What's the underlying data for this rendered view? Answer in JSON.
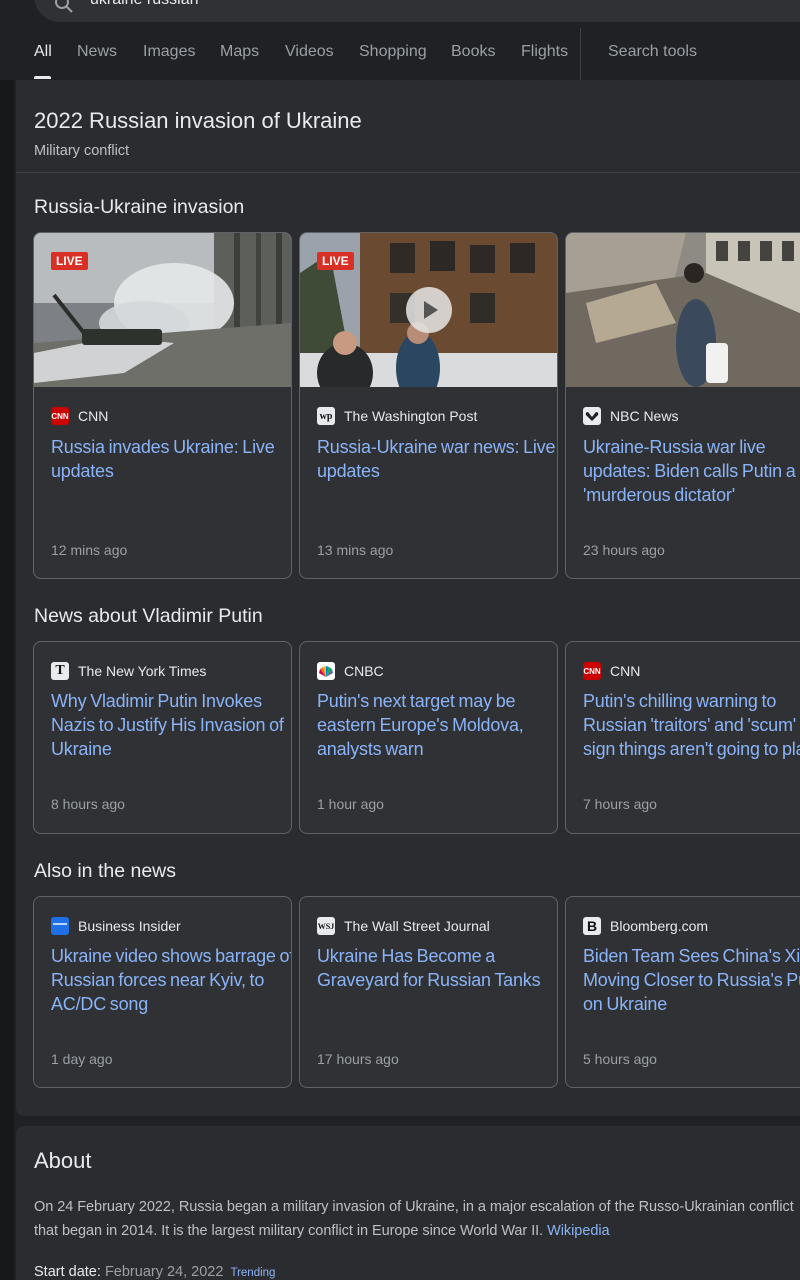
{
  "search": {
    "query": "ukraine russian"
  },
  "tabs": [
    {
      "label": "All",
      "active": true
    },
    {
      "label": "News"
    },
    {
      "label": "Images"
    },
    {
      "label": "Maps"
    },
    {
      "label": "Videos"
    },
    {
      "label": "Shopping"
    },
    {
      "label": "Books"
    },
    {
      "label": "Flights"
    },
    {
      "label": "Search tools"
    }
  ],
  "knowledge_panel": {
    "title": "2022 Russian invasion of Ukraine",
    "subtitle": "Military conflict"
  },
  "sections": [
    {
      "title": "Russia-Ukraine invasion",
      "cards": [
        {
          "badge": "LIVE",
          "source": "CNN",
          "logo": "cnn-logo",
          "headline": "Russia invades Ukraine: Live updates",
          "time": "12 mins ago"
        },
        {
          "badge": "LIVE",
          "source": "The Washington Post",
          "logo": "wapo-logo",
          "headline": "Russia-Ukraine war news: Live updates",
          "time": "13 mins ago",
          "video": true
        },
        {
          "source": "NBC News",
          "logo": "nbc-logo",
          "headline": "Ukraine-Russia war live updates: Biden calls Putin a 'murderous dictator'",
          "time": "23 hours ago"
        }
      ]
    },
    {
      "title": "News about Vladimir Putin",
      "cards": [
        {
          "source": "The New York Times",
          "logo": "nyt-logo",
          "headline": "Why Vladimir Putin Invokes Nazis to Justify His Invasion of Ukraine",
          "time": "8 hours ago"
        },
        {
          "source": "CNBC",
          "logo": "cnbc-logo",
          "headline": "Putin's next target may be eastern Europe's Moldova, analysts warn",
          "time": "1 hour ago"
        },
        {
          "source": "CNN",
          "logo": "cnn-logo",
          "headline": "Putin's chilling warning to Russian 'traitors' and 'scum' is a sign things aren't going to plan",
          "time": "7 hours ago"
        }
      ]
    },
    {
      "title": "Also in the news",
      "cards": [
        {
          "source": "Business Insider",
          "logo": "business-insider-logo",
          "headline": "Ukraine video shows barrage of Russian forces near Kyiv, to AC/DC song",
          "time": "1 day ago"
        },
        {
          "source": "The Wall Street Journal",
          "logo": "wsj-logo",
          "headline": "Ukraine Has Become a Graveyard for Russian Tanks",
          "time": "17 hours ago"
        },
        {
          "source": "Bloomberg.com",
          "logo": "bloomberg-logo",
          "headline": "Biden Team Sees China's Xi Moving Closer to Russia's Putin on Ukraine",
          "time": "5 hours ago"
        }
      ]
    }
  ],
  "about": {
    "title": "About",
    "text": "On 24 February 2022, Russia began a military invasion of Ukraine, in a major escalation of the Russo-Ukrainian conflict that began in 2014. It is the largest military conflict in Europe since World War II.",
    "link": "Wikipedia",
    "fact_label": "Start date:",
    "fact_value": "February 24, 2022",
    "fact_tag": "Trending"
  },
  "colors": {
    "background": "#202124",
    "card": "#303134",
    "link": "#8ab4f8",
    "live": "#d93025"
  }
}
